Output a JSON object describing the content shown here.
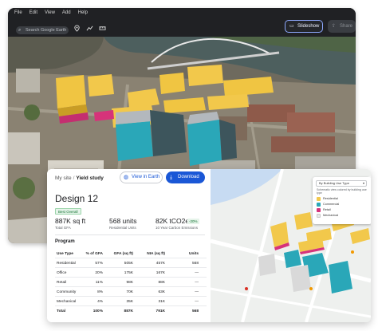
{
  "menubar": {
    "items": [
      "File",
      "Edit",
      "View",
      "Add",
      "Help"
    ],
    "search_placeholder": "Search Google Earth",
    "slideshow_label": "Slideshow",
    "share_label": "Share"
  },
  "card": {
    "breadcrumb_parent": "My site",
    "breadcrumb_current": "Yield study",
    "view_in_earth_label": "View in Earth",
    "download_label": "Download",
    "title": "Design 12",
    "badge": "Best Overall",
    "metrics": [
      {
        "value": "887K sq ft",
        "label": "Total GFA"
      },
      {
        "value": "568 units",
        "label": "Residential Units"
      },
      {
        "value": "82K tCO2e",
        "label": "10 Year Carbon Emissions"
      }
    ],
    "change_badge": "-20%",
    "program_title": "Program",
    "table": {
      "headers": [
        "Use Type",
        "% of GFA",
        "GFA (sq ft)",
        "NIA (sq ft)",
        "Units"
      ],
      "rows": [
        [
          "Residential",
          "57%",
          "505K",
          "457K",
          "568"
        ],
        [
          "Office",
          "20%",
          "175K",
          "167K",
          "—"
        ],
        [
          "Retail",
          "11%",
          "98K",
          "88K",
          "—"
        ],
        [
          "Community",
          "8%",
          "70K",
          "63K",
          "—"
        ],
        [
          "Mechanical",
          "4%",
          "35K",
          "31K",
          "—"
        ]
      ],
      "total": [
        "Total",
        "100%",
        "887K",
        "791K",
        "568"
      ]
    }
  },
  "legend": {
    "select_label": "By Building Use Type",
    "note": "Schematic view colored by building use type",
    "items": [
      {
        "label": "Residential",
        "color": "#f2c84b"
      },
      {
        "label": "Commercial",
        "color": "#2aa7b8"
      },
      {
        "label": "Retail",
        "color": "#d6337a"
      },
      {
        "label": "Mechanical",
        "color": "#e8e8e8"
      }
    ]
  },
  "colors": {
    "accent": "#1a57d6",
    "residential": "#f2c84b",
    "commercial": "#2aa7b8",
    "retail": "#d6337a"
  }
}
